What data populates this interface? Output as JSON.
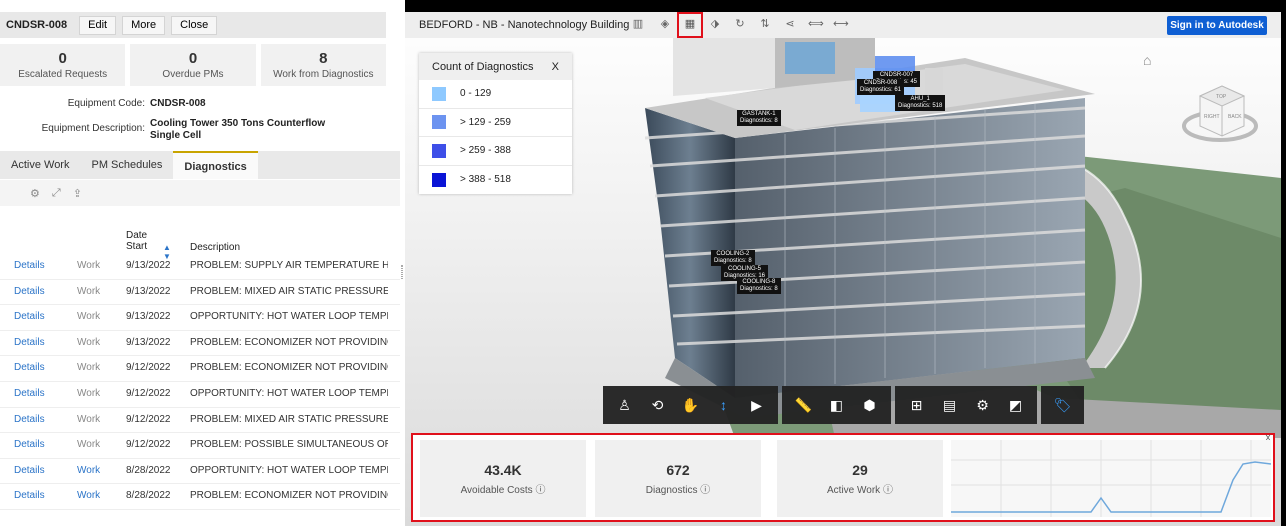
{
  "left": {
    "equipment_id": "CNDSR-008",
    "buttons": {
      "edit": "Edit",
      "more": "More",
      "close": "Close"
    },
    "stats": [
      {
        "value": "0",
        "label": "Escalated Requests"
      },
      {
        "value": "0",
        "label": "Overdue PMs"
      },
      {
        "value": "8",
        "label": "Work from Diagnostics"
      }
    ],
    "info": {
      "code_label": "Equipment Code:",
      "code_value": "CNDSR-008",
      "desc_label": "Equipment Description:",
      "desc_value": "Cooling Tower 350 Tons Counterflow Single Cell"
    },
    "tabs": [
      "Active Work",
      "PM Schedules",
      "Diagnostics"
    ],
    "table": {
      "date_header": "Date Start",
      "desc_header": "Description",
      "rows": [
        {
          "link": "Details",
          "type": "Work",
          "date": "9/13/2022",
          "desc": "PROBLEM: SUPPLY AIR TEMPERATURE HIGHER"
        },
        {
          "link": "Details",
          "type": "Work",
          "date": "9/13/2022",
          "desc": "PROBLEM: MIXED AIR STATIC PRESSURE SMALI"
        },
        {
          "link": "Details",
          "type": "Work",
          "date": "9/13/2022",
          "desc": "OPPORTUNITY: HOT WATER LOOP TEMPERATU"
        },
        {
          "link": "Details",
          "type": "Work",
          "date": "9/13/2022",
          "desc": "PROBLEM: ECONOMIZER NOT PROVIDING TOT"
        },
        {
          "link": "Details",
          "type": "Work",
          "date": "9/12/2022",
          "desc": "PROBLEM: ECONOMIZER NOT PROVIDING TOT"
        },
        {
          "link": "Details",
          "type": "Work",
          "date": "9/12/2022",
          "desc": "OPPORTUNITY: HOT WATER LOOP TEMPERATU"
        },
        {
          "link": "Details",
          "type": "Work",
          "date": "9/12/2022",
          "desc": "PROBLEM: MIXED AIR STATIC PRESSURE SMALI"
        },
        {
          "link": "Details",
          "type": "Work",
          "date": "9/12/2022",
          "desc": "PROBLEM: POSSIBLE SIMULTANEOUS OR EXCE"
        },
        {
          "link": "Details",
          "type": "Work",
          "date": "8/28/2022",
          "desc": "OPPORTUNITY: HOT WATER LOOP TEMPERATU"
        },
        {
          "link": "Details",
          "type": "Work",
          "date": "8/28/2022",
          "desc": "PROBLEM: ECONOMIZER NOT PROVIDING TOT"
        }
      ]
    }
  },
  "viewer": {
    "title": "BEDFORD - NB - Nanotechnology Building",
    "sign_in": "Sign in to Autodesk",
    "legend": {
      "title": "Count of Diagnostics",
      "close": "X",
      "items": [
        {
          "range": "0 - 129",
          "color": "#8ec9ff"
        },
        {
          "range": "> 129 - 259",
          "color": "#6c93f0"
        },
        {
          "range": "> 259 - 388",
          "color": "#3e4fe8"
        },
        {
          "range": "> 388 - 518",
          "color": "#0a14d6"
        }
      ]
    },
    "labels": [
      {
        "name": "CNDSR-007",
        "value": "Diagnostics: 45"
      },
      {
        "name": "CNDSR-008",
        "value": "Diagnostics: 61"
      },
      {
        "name": "AHU_1",
        "value": "Diagnostics: 518"
      },
      {
        "name": "GASTANK-1",
        "value": "Diagnostics: 8"
      },
      {
        "name": "COOLING-2",
        "value": "Diagnostics: 8"
      },
      {
        "name": "COOLING-5",
        "value": "Diagnostics: 16"
      },
      {
        "name": "COOLING-8",
        "value": "Diagnostics: 8"
      }
    ],
    "kpis": [
      {
        "value": "43.4K",
        "label": "Avoidable Costs"
      },
      {
        "value": "672",
        "label": "Diagnostics"
      },
      {
        "value": "29",
        "label": "Active Work"
      }
    ],
    "bottom_close": "X",
    "cube": {
      "top": "TOP",
      "right": "RIGHT",
      "back": "BACK"
    }
  },
  "accent_colors": {
    "highlight": "#e0101b",
    "link": "#2b74c8",
    "signin": "#0f5fd3"
  }
}
